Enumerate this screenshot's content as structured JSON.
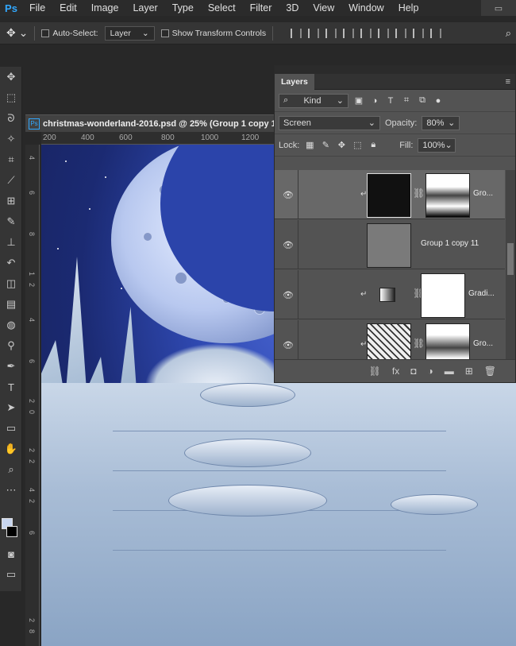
{
  "app": {
    "logo": "Ps"
  },
  "menu": [
    "File",
    "Edit",
    "Image",
    "Layer",
    "Type",
    "Select",
    "Filter",
    "3D",
    "View",
    "Window",
    "Help"
  ],
  "options_bar": {
    "auto_select_label": "Auto-Select:",
    "auto_select_target": "Layer",
    "show_transform_label": "Show Transform Controls"
  },
  "document": {
    "tab_title": "christmas-wonderland-2016.psd @ 25% (Group 1 copy 1",
    "ruler_top": [
      "200",
      "400",
      "600",
      "800",
      "1000",
      "1200"
    ],
    "ruler_left": [
      "4",
      "6",
      "8",
      "1",
      "2",
      "4",
      "6",
      "2",
      "0",
      "2",
      "2",
      "4",
      "2",
      "6",
      "2",
      "8"
    ]
  },
  "layers_panel": {
    "tab_label": "Layers",
    "filter_kind": "Kind",
    "blend_mode": "Screen",
    "opacity_label": "Opacity:",
    "opacity_value": "80%",
    "lock_label": "Lock:",
    "fill_label": "Fill:",
    "fill_value": "100%",
    "layers": [
      {
        "name": "Gro...",
        "selected": true,
        "clipped": true,
        "has_mask": true
      },
      {
        "name": "Group 1 copy 11",
        "selected": false,
        "clipped": false,
        "has_mask": false
      },
      {
        "name": "Gradi...",
        "selected": false,
        "clipped": true,
        "has_mask": true
      },
      {
        "name": "Gro...",
        "selected": false,
        "clipped": true,
        "has_mask": true
      }
    ]
  },
  "colors": {
    "foreground": "#c8d6f0",
    "background": "#000000",
    "accent": "#31a8ff"
  }
}
